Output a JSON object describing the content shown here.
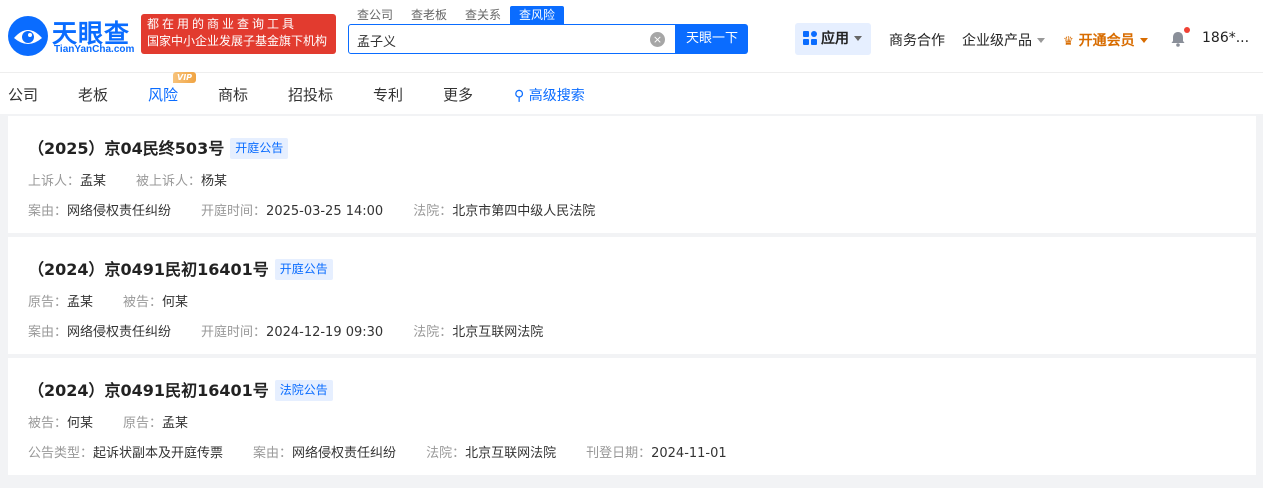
{
  "brand": {
    "name": "天眼查",
    "domain": "TianYanCha.com",
    "slogan_line1": "都在用的商业查询工具",
    "slogan_line2": "国家中小企业发展子基金旗下机构"
  },
  "search": {
    "tabs": [
      "查公司",
      "查老板",
      "查关系",
      "查风险"
    ],
    "active_tab": 3,
    "query": "孟子义",
    "button_label": "天眼一下"
  },
  "header_nav": {
    "app_label": "应用",
    "business": "商务合作",
    "enterprise": "企业级产品",
    "vip": "开通会员",
    "user": "186*..."
  },
  "subnav": {
    "items": [
      "公司",
      "老板",
      "风险",
      "商标",
      "招投标",
      "专利",
      "更多"
    ],
    "active_index": 2,
    "vip_tag": "VIP",
    "advanced_search": "高级搜索"
  },
  "results": [
    {
      "case_no": "（2025）京04民终503号",
      "tag": "开庭公告",
      "parties": [
        {
          "label": "上诉人：",
          "value": "孟某"
        },
        {
          "label": "被上诉人：",
          "value": "杨某"
        }
      ],
      "details": [
        {
          "label": "案由：",
          "value": "网络侵权责任纠纷"
        },
        {
          "label": "开庭时间：",
          "value": "2025-03-25 14:00"
        },
        {
          "label": "法院：",
          "value": "北京市第四中级人民法院"
        }
      ]
    },
    {
      "case_no": "（2024）京0491民初16401号",
      "tag": "开庭公告",
      "parties": [
        {
          "label": "原告：",
          "value": "孟某"
        },
        {
          "label": "被告：",
          "value": "何某"
        }
      ],
      "details": [
        {
          "label": "案由：",
          "value": "网络侵权责任纠纷"
        },
        {
          "label": "开庭时间：",
          "value": "2024-12-19 09:30"
        },
        {
          "label": "法院：",
          "value": "北京互联网法院"
        }
      ]
    },
    {
      "case_no": "（2024）京0491民初16401号",
      "tag": "法院公告",
      "parties": [
        {
          "label": "被告：",
          "value": "何某"
        },
        {
          "label": "原告：",
          "value": "孟某"
        }
      ],
      "details": [
        {
          "label": "公告类型：",
          "value": "起诉状副本及开庭传票"
        },
        {
          "label": "案由：",
          "value": "网络侵权责任纠纷"
        },
        {
          "label": "法院：",
          "value": "北京互联网法院"
        },
        {
          "label": "刊登日期：",
          "value": "2024-11-01"
        }
      ]
    }
  ],
  "colors": {
    "brand_blue": "#0a6cff",
    "slogan_red": "#e23b2f",
    "vip_orange": "#d86c00"
  }
}
